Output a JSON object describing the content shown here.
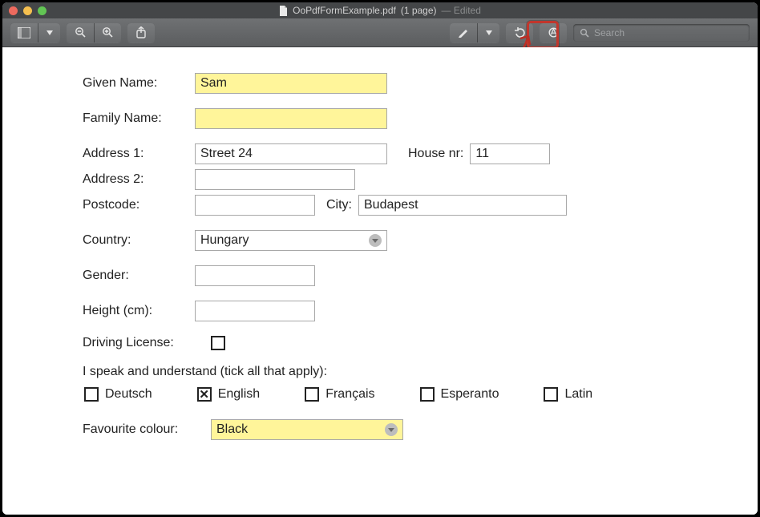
{
  "window": {
    "filename": "OoPdfFormExample.pdf",
    "page_count_label": "(1 page)",
    "edited_label": "— Edited"
  },
  "toolbar": {
    "search_placeholder": "Search"
  },
  "annotation": {
    "highlight_target": "share-markup-button"
  },
  "form": {
    "given_name": {
      "label": "Given Name:",
      "value": "Sam"
    },
    "family_name": {
      "label": "Family Name:",
      "value": ""
    },
    "address1": {
      "label": "Address 1:",
      "value": "Street 24"
    },
    "house_nr": {
      "label": "House nr:",
      "value": "11"
    },
    "address2": {
      "label": "Address 2:",
      "value": ""
    },
    "postcode": {
      "label": "Postcode:",
      "value": ""
    },
    "city": {
      "label": "City:",
      "value": "Budapest"
    },
    "country": {
      "label": "Country:",
      "value": "Hungary"
    },
    "gender": {
      "label": "Gender:",
      "value": ""
    },
    "height": {
      "label": "Height (cm):",
      "value": ""
    },
    "driving": {
      "label": "Driving License:",
      "checked": false
    },
    "languages_prompt": "I speak and understand (tick all that apply):",
    "languages": [
      {
        "label": "Deutsch",
        "checked": false
      },
      {
        "label": "English",
        "checked": true
      },
      {
        "label": "Français",
        "checked": false
      },
      {
        "label": "Esperanto",
        "checked": false
      },
      {
        "label": "Latin",
        "checked": false
      }
    ],
    "fav_colour": {
      "label": "Favourite colour:",
      "value": "Black"
    }
  }
}
